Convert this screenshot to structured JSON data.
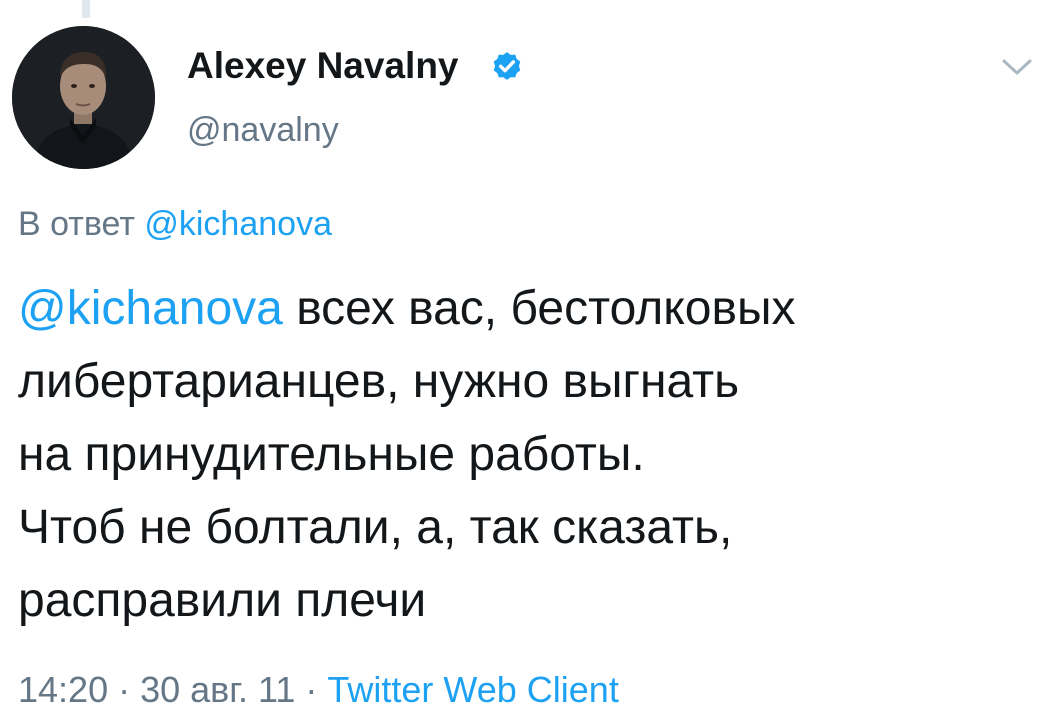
{
  "author": {
    "display_name": "Alexey Navalny",
    "handle": "@navalny",
    "verified": true
  },
  "reply_context": {
    "prefix": "В ответ",
    "mention": "@kichanova"
  },
  "tweet": {
    "mention": "@kichanova",
    "lines": [
      " всех вас, бестолковых",
      "либертарианцев, нужно выгнать",
      "на принудительные работы.",
      "Чтоб не болтали, а, так сказать,",
      "расправили плечи"
    ]
  },
  "meta": {
    "time": "14:20",
    "separator": " · ",
    "date": "30 авг. 11",
    "source": "Twitter Web Client"
  },
  "icons": {
    "verified": "verified-badge-icon",
    "menu": "chevron-down-icon"
  },
  "colors": {
    "link": "#1da1f2",
    "text": "#14171a",
    "secondary": "#657786",
    "thread_line": "#e1e8ed"
  }
}
